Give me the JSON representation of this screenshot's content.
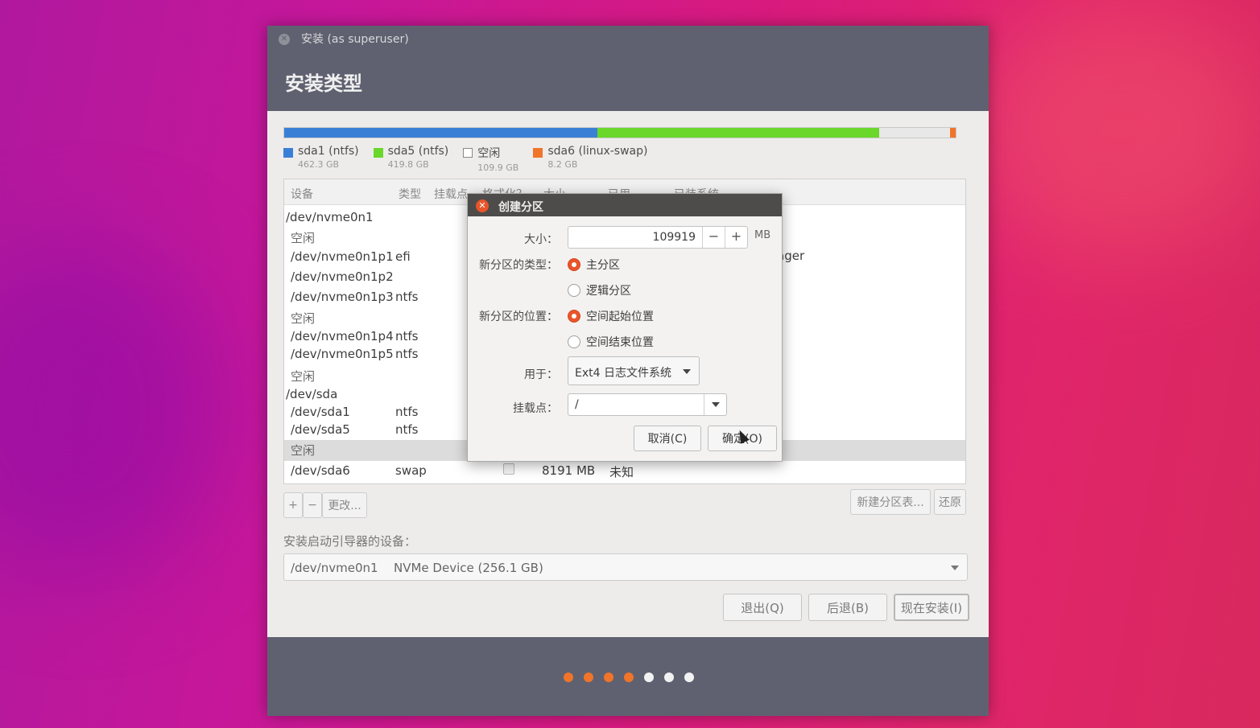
{
  "window": {
    "title": "安装 (as superuser)",
    "heading": "安装类型"
  },
  "diskbar": {
    "segments": [
      {
        "name": "sda1",
        "color": "#3a7fd6",
        "fraction": 0.466
      },
      {
        "name": "sda5",
        "color": "#6ad72a",
        "fraction": 0.42
      },
      {
        "name": "free",
        "color": "#e8e8e8",
        "fraction": 0.106
      },
      {
        "name": "sda6",
        "color": "#f0742a",
        "fraction": 0.008
      }
    ]
  },
  "legend": [
    {
      "name": "sda1 (ntfs)",
      "size": "462.3 GB",
      "color": "#3a7fd6"
    },
    {
      "name": "sda5 (ntfs)",
      "size": "419.8 GB",
      "color": "#6ad72a"
    },
    {
      "name": "空闲",
      "size": "109.9 GB",
      "color": "#ffffff"
    },
    {
      "name": "sda6 (linux-swap)",
      "size": "8.2 GB",
      "color": "#f0742a"
    }
  ],
  "table": {
    "headers": {
      "device": "设备",
      "type": "类型",
      "mount": "挂载点",
      "format": "格式化？",
      "size": "大小",
      "used": "已用",
      "system": "已装系统"
    },
    "rows": [
      {
        "device": "/dev/nvme0n1",
        "type": "",
        "indent": 0
      },
      {
        "device": "空闲",
        "type": "",
        "indent": 1
      },
      {
        "device": "/dev/nvme0n1p1",
        "type": "efi",
        "indent": 1
      },
      {
        "device": "/dev/nvme0n1p2",
        "type": "",
        "indent": 1
      },
      {
        "device": "/dev/nvme0n1p3",
        "type": "ntfs",
        "indent": 1
      },
      {
        "device": "空闲",
        "type": "",
        "indent": 1
      },
      {
        "device": "/dev/nvme0n1p4",
        "type": "ntfs",
        "indent": 1
      },
      {
        "device": "/dev/nvme0n1p5",
        "type": "ntfs",
        "indent": 1
      },
      {
        "device": "空闲",
        "type": "",
        "indent": 1
      },
      {
        "device": "/dev/sda",
        "type": "",
        "indent": 0
      },
      {
        "device": "/dev/sda1",
        "type": "ntfs",
        "indent": 1
      },
      {
        "device": "/dev/sda5",
        "type": "ntfs",
        "indent": 1
      },
      {
        "device": "空闲",
        "type": "",
        "indent": 1,
        "selected": true
      },
      {
        "device": "/dev/sda6",
        "type": "swap",
        "indent": 1,
        "size": "8191 MB",
        "used": "未知"
      }
    ],
    "partial_system_text": "ager"
  },
  "table_buttons": {
    "add": "+",
    "remove": "−",
    "change": "更改...",
    "new_table": "新建分区表...",
    "revert": "还原"
  },
  "bootloader": {
    "label": "安装启动引导器的设备：",
    "device": "/dev/nvme0n1",
    "description": "NVMe Device (256.1 GB)"
  },
  "actions": {
    "quit": "退出(Q)",
    "back": "后退(B)",
    "install": "现在安装(I)"
  },
  "progress_dots": [
    {
      "color": "#f0742a"
    },
    {
      "color": "#f0742a"
    },
    {
      "color": "#f0742a"
    },
    {
      "color": "#f0742a"
    },
    {
      "color": "#f2f2f2"
    },
    {
      "color": "#f2f2f2"
    },
    {
      "color": "#f2f2f2"
    }
  ],
  "dialog": {
    "title": "创建分区",
    "size_label": "大小：",
    "size_value": "109919",
    "minus": "−",
    "plus": "+",
    "unit": "MB",
    "type_label": "新分区的类型：",
    "type_primary": "主分区",
    "type_logical": "逻辑分区",
    "location_label": "新分区的位置：",
    "location_start": "空间起始位置",
    "location_end": "空间结束位置",
    "use_label": "用于：",
    "use_value": "Ext4 日志文件系统",
    "mount_label": "挂载点：",
    "mount_value": "/",
    "cancel": "取消(C)",
    "ok": "确定(O)"
  }
}
